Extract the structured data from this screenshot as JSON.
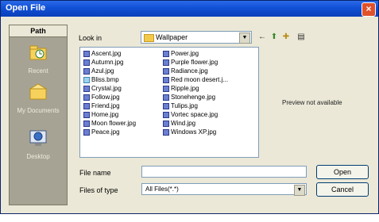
{
  "window": {
    "title": "Open File",
    "close_label": "×"
  },
  "places": {
    "header": "Path",
    "items": [
      {
        "label": "Recent",
        "icon": "recent-folder-icon"
      },
      {
        "label": "My Documents",
        "icon": "documents-folder-icon"
      },
      {
        "label": "Desktop",
        "icon": "desktop-icon"
      }
    ]
  },
  "lookin": {
    "label": "Look in",
    "value": "Wallpaper"
  },
  "toolbar": {
    "back": "←",
    "up": "⬆",
    "new_folder": "✚",
    "view": "▤"
  },
  "files": [
    {
      "name": "Ascent.jpg",
      "type": "jpg"
    },
    {
      "name": "Autumn.jpg",
      "type": "jpg"
    },
    {
      "name": "Azul.jpg",
      "type": "jpg"
    },
    {
      "name": "Bliss.bmp",
      "type": "bmp"
    },
    {
      "name": "Crystal.jpg",
      "type": "jpg"
    },
    {
      "name": "Follow.jpg",
      "type": "jpg"
    },
    {
      "name": "Friend.jpg",
      "type": "jpg"
    },
    {
      "name": "Home.jpg",
      "type": "jpg"
    },
    {
      "name": "Moon flower.jpg",
      "type": "jpg"
    },
    {
      "name": "Peace.jpg",
      "type": "jpg"
    },
    {
      "name": "Power.jpg",
      "type": "jpg"
    },
    {
      "name": "Purple flower.jpg",
      "type": "jpg"
    },
    {
      "name": "Radiance.jpg",
      "type": "jpg"
    },
    {
      "name": "Red moon desert.j...",
      "type": "jpg"
    },
    {
      "name": "Ripple.jpg",
      "type": "jpg"
    },
    {
      "name": "Stonehenge.jpg",
      "type": "jpg"
    },
    {
      "name": "Tulips.jpg",
      "type": "jpg"
    },
    {
      "name": "Vortec space.jpg",
      "type": "jpg"
    },
    {
      "name": "Wind.jpg",
      "type": "jpg"
    },
    {
      "name": "Windows XP.jpg",
      "type": "jpg"
    }
  ],
  "preview": {
    "text": "Preview not available"
  },
  "filename": {
    "label": "File name",
    "value": ""
  },
  "filetype": {
    "label": "Files of type",
    "value": "All Files(*.*)"
  },
  "buttons": {
    "open": "Open",
    "cancel": "Cancel"
  },
  "colors": {
    "titlebar": "#1150d6",
    "dialog_bg": "#ebe8d7",
    "places_bg": "#a7a394",
    "close": "#e0512b"
  }
}
